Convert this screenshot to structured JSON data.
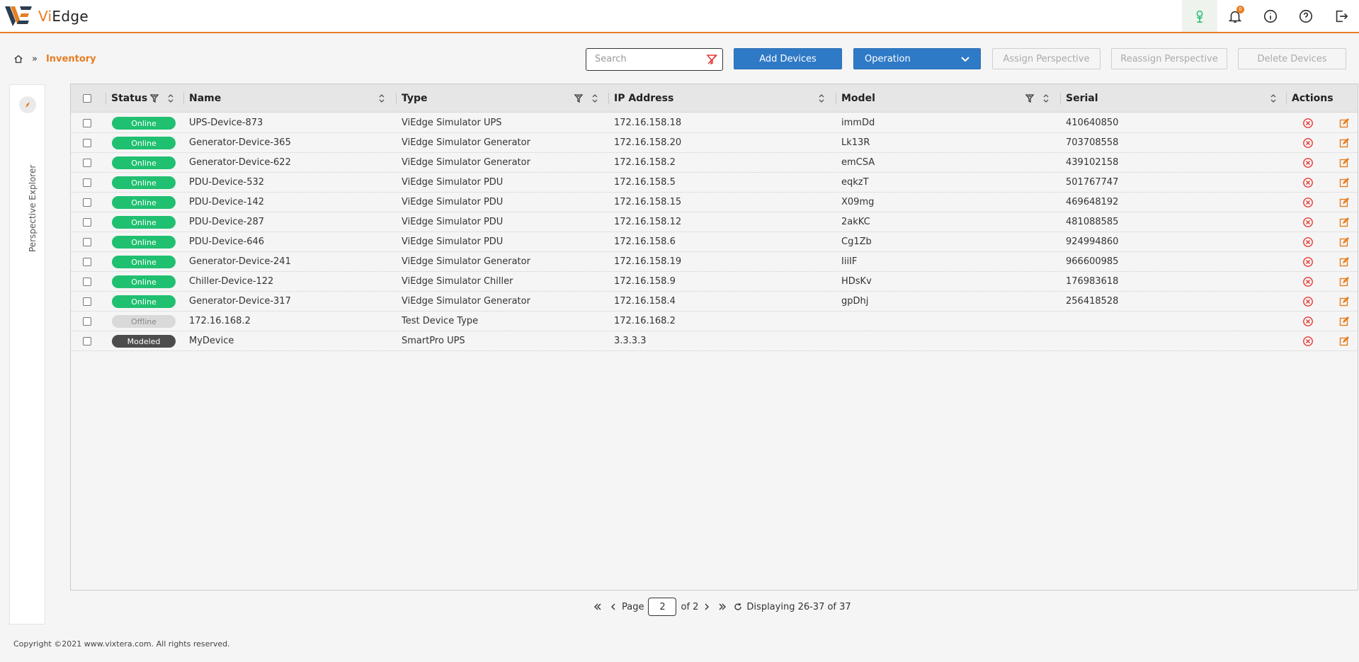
{
  "header": {
    "brand_prefix": "Vi",
    "brand_suffix": "Edge",
    "notification_count": "0",
    "icons": [
      "tree-icon",
      "bell-icon",
      "info-icon",
      "help-icon",
      "logout-icon"
    ]
  },
  "breadcrumb": {
    "current": "Inventory",
    "separator": "»"
  },
  "toolbar": {
    "search_placeholder": "Search",
    "add_devices": "Add Devices",
    "operation": "Operation",
    "assign_perspective": "Assign Perspective",
    "reassign_perspective": "Reassign Perspective",
    "delete_devices": "Delete Devices"
  },
  "side_panel": {
    "title": "Perspective Explorer"
  },
  "table": {
    "columns": {
      "status": "Status",
      "name": "Name",
      "type": "Type",
      "ip": "IP Address",
      "model": "Model",
      "serial": "Serial",
      "actions": "Actions"
    },
    "rows": [
      {
        "status": "Online",
        "name": "UPS-Device-873",
        "type": "ViEdge Simulator UPS",
        "ip": "172.16.158.18",
        "model": "immDd",
        "serial": "410640850"
      },
      {
        "status": "Online",
        "name": "Generator-Device-365",
        "type": "ViEdge Simulator Generator",
        "ip": "172.16.158.20",
        "model": "Lk13R",
        "serial": "703708558"
      },
      {
        "status": "Online",
        "name": "Generator-Device-622",
        "type": "ViEdge Simulator Generator",
        "ip": "172.16.158.2",
        "model": "emCSA",
        "serial": "439102158"
      },
      {
        "status": "Online",
        "name": "PDU-Device-532",
        "type": "ViEdge Simulator PDU",
        "ip": "172.16.158.5",
        "model": "eqkzT",
        "serial": "501767747"
      },
      {
        "status": "Online",
        "name": "PDU-Device-142",
        "type": "ViEdge Simulator PDU",
        "ip": "172.16.158.15",
        "model": "X09mg",
        "serial": "469648192"
      },
      {
        "status": "Online",
        "name": "PDU-Device-287",
        "type": "ViEdge Simulator PDU",
        "ip": "172.16.158.12",
        "model": "2akKC",
        "serial": "481088585"
      },
      {
        "status": "Online",
        "name": "PDU-Device-646",
        "type": "ViEdge Simulator PDU",
        "ip": "172.16.158.6",
        "model": "Cg1Zb",
        "serial": "924994860"
      },
      {
        "status": "Online",
        "name": "Generator-Device-241",
        "type": "ViEdge Simulator Generator",
        "ip": "172.16.158.19",
        "model": "IiiIF",
        "serial": "966600985"
      },
      {
        "status": "Online",
        "name": "Chiller-Device-122",
        "type": "ViEdge Simulator Chiller",
        "ip": "172.16.158.9",
        "model": "HDsKv",
        "serial": "176983618"
      },
      {
        "status": "Online",
        "name": "Generator-Device-317",
        "type": "ViEdge Simulator Generator",
        "ip": "172.16.158.4",
        "model": "gpDhj",
        "serial": "256418528"
      },
      {
        "status": "Offline",
        "name": "172.16.168.2",
        "type": "Test Device Type",
        "ip": "172.16.168.2",
        "model": "",
        "serial": ""
      },
      {
        "status": "Modeled",
        "name": "MyDevice",
        "type": "SmartPro UPS",
        "ip": "3.3.3.3",
        "model": "",
        "serial": ""
      }
    ]
  },
  "pager": {
    "page_label": "Page",
    "page_value": "2",
    "of_label": "of 2",
    "displaying": "Displaying 26-37 of 37"
  },
  "footer": {
    "copyright": "Copyright ©2021 www.vixtera.com. All rights reserved."
  },
  "colors": {
    "accent": "#e67e22",
    "primary": "#2f7ac6",
    "online": "#20c071",
    "offline": "#d9d9d9",
    "modeled": "#4c4c4c",
    "delete_icon": "#e53935",
    "edit_icon": "#e67e22"
  }
}
